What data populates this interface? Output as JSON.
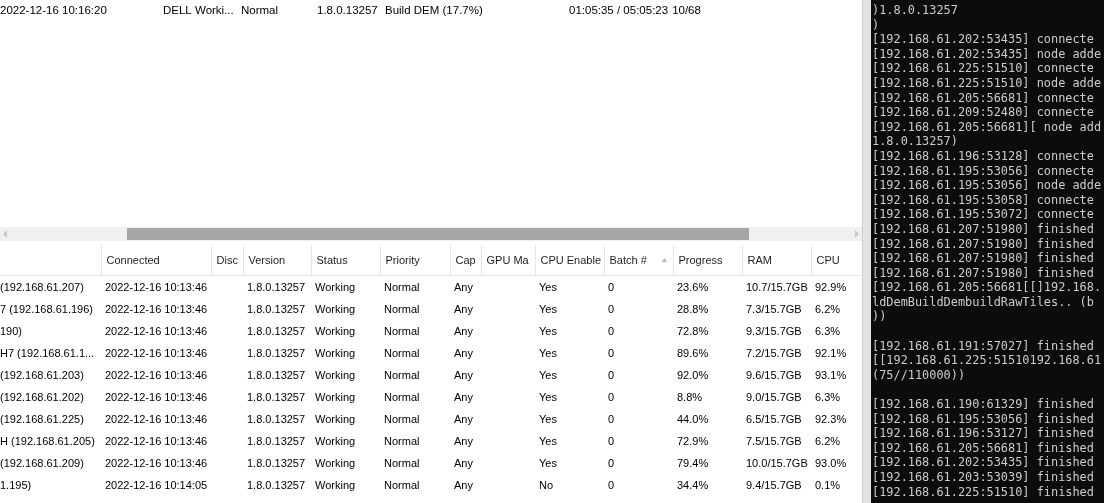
{
  "jobs_list": {
    "rows": [
      {
        "cells": [
          "2022-12-16 10:16:20",
          "DELL",
          "Worki...",
          "Normal",
          "1.8.0.13257",
          "Build DEM (17.7%)",
          "01:05:35 / 05:05:23",
          "10/68"
        ]
      }
    ]
  },
  "nodes_table": {
    "columns": [
      {
        "sort_ascending": false
      },
      {
        "label": "Connected",
        "sort_ascending": false
      },
      {
        "label": "Disc",
        "sort_ascending": false
      },
      {
        "label": "Version",
        "sort_ascending": false
      },
      {
        "label": "Status",
        "sort_ascending": false
      },
      {
        "label": "Priority",
        "sort_ascending": false
      },
      {
        "label": "Cap",
        "sort_ascending": false
      },
      {
        "label": "GPU Ma",
        "sort_ascending": false
      },
      {
        "label": "CPU Enable",
        "sort_ascending": false
      },
      {
        "label": "Batch #",
        "sort_ascending": true
      },
      {
        "label": "Progress",
        "sort_ascending": false
      },
      {
        "label": "RAM",
        "sort_ascending": false
      },
      {
        "label": "CPU",
        "sort_ascending": false
      }
    ],
    "rows": [
      {
        "cells": [
          "(192.168.61.207)",
          "2022-12-16 10:13:46",
          null,
          "1.8.0.13257",
          "Working",
          "Normal",
          "Any",
          null,
          "Yes",
          "0",
          "23.6%",
          "10.7/15.7GB",
          "92.9%"
        ]
      },
      {
        "cells": [
          "7 (192.168.61.196)",
          "2022-12-16 10:13:46",
          null,
          "1.8.0.13257",
          "Working",
          "Normal",
          "Any",
          null,
          "Yes",
          "0",
          "28.8%",
          "7.3/15.7GB",
          "6.2%"
        ]
      },
      {
        "cells": [
          "190)",
          "2022-12-16 10:13:46",
          null,
          "1.8.0.13257",
          "Working",
          "Normal",
          "Any",
          null,
          "Yes",
          "0",
          "72.8%",
          "9.3/15.7GB",
          "6.3%"
        ]
      },
      {
        "cells": [
          "H7 (192.168.61.1...",
          "2022-12-16 10:13:46",
          null,
          "1.8.0.13257",
          "Working",
          "Normal",
          "Any",
          null,
          "Yes",
          "0",
          "89.6%",
          "7.2/15.7GB",
          "92.1%"
        ]
      },
      {
        "cells": [
          "(192.168.61.203)",
          "2022-12-16 10:13:46",
          null,
          "1.8.0.13257",
          "Working",
          "Normal",
          "Any",
          null,
          "Yes",
          "0",
          "92.0%",
          "9.6/15.7GB",
          "93.1%"
        ]
      },
      {
        "cells": [
          "(192.168.61.202)",
          "2022-12-16 10:13:46",
          null,
          "1.8.0.13257",
          "Working",
          "Normal",
          "Any",
          null,
          "Yes",
          "0",
          "8.8%",
          "9.0/15.7GB",
          "6.3%"
        ]
      },
      {
        "cells": [
          "(192.168.61.225)",
          "2022-12-16 10:13:46",
          null,
          "1.8.0.13257",
          "Working",
          "Normal",
          "Any",
          null,
          "Yes",
          "0",
          "44.0%",
          "6.5/15.7GB",
          "92.3%"
        ]
      },
      {
        "cells": [
          "H (192.168.61.205)",
          "2022-12-16 10:13:46",
          null,
          "1.8.0.13257",
          "Working",
          "Normal",
          "Any",
          null,
          "Yes",
          "0",
          "72.9%",
          "7.5/15.7GB",
          "6.2%"
        ]
      },
      {
        "cells": [
          "(192.168.61.209)",
          "2022-12-16 10:13:46",
          null,
          "1.8.0.13257",
          "Working",
          "Normal",
          "Any",
          null,
          "Yes",
          "0",
          "79.4%",
          "10.0/15.7GB",
          "93.0%"
        ]
      },
      {
        "cells": [
          "1.195)",
          "2022-12-16 10:14:05",
          null,
          "1.8.0.13257",
          "Working",
          "Normal",
          "Any",
          null,
          "No",
          "0",
          "34.4%",
          "9.4/15.7GB",
          "0.1%"
        ]
      }
    ]
  },
  "console": {
    "lines": [
      {
        "text": ")1.8.0.13257",
        "blank_before": false
      },
      {
        "text": ")",
        "blank_before": false
      },
      {
        "text": "[192.168.61.202:53435] connecte",
        "blank_before": false
      },
      {
        "text": "[192.168.61.202:53435] node adde",
        "blank_before": false
      },
      {
        "text": "[192.168.61.225:51510] connecte",
        "blank_before": false
      },
      {
        "text": "[192.168.61.225:51510] node adde",
        "blank_before": false
      },
      {
        "text": "[192.168.61.205:56681] connecte",
        "blank_before": false
      },
      {
        "text": "[192.168.61.209:52480] connecte",
        "blank_before": false
      },
      {
        "text": "[192.168.61.205:56681][ node add",
        "blank_before": false
      },
      {
        "text": "1.8.0.13257)",
        "blank_before": false
      },
      {
        "text": "[192.168.61.196:53128] connecte",
        "blank_before": false
      },
      {
        "text": "[192.168.61.195:53056] connecte",
        "blank_before": false
      },
      {
        "text": "[192.168.61.195:53056] node adde",
        "blank_before": false
      },
      {
        "text": "[192.168.61.195:53058] connecte",
        "blank_before": false
      },
      {
        "text": "[192.168.61.195:53072] connecte",
        "blank_before": false
      },
      {
        "text": "[192.168.61.207:51980] finished",
        "blank_before": false
      },
      {
        "text": "[192.168.61.207:51980] finished",
        "blank_before": false
      },
      {
        "text": "[192.168.61.207:51980] finished",
        "blank_before": false
      },
      {
        "text": "[192.168.61.207:51980] finished",
        "blank_before": false
      },
      {
        "text": "[192.168.61.205:56681[[]192.168.",
        "blank_before": false
      },
      {
        "text": "ldDemBuildDembuildRawTiles.. (b",
        "blank_before": false
      },
      {
        "text": "))",
        "blank_before": false
      },
      {
        "text": "[192.168.61.191:57027] finished",
        "blank_before": true
      },
      {
        "text": "[[192.168.61.225:51510192.168.61",
        "blank_before": false
      },
      {
        "text": "(75//110000))",
        "blank_before": false
      },
      {
        "text": "[192.168.61.190:61329] finished",
        "blank_before": true
      },
      {
        "text": "[192.168.61.195:53056] finished",
        "blank_before": false
      },
      {
        "text": "[192.168.61.196:53127] finished",
        "blank_before": false
      },
      {
        "text": "[192.168.61.205:56681] finished",
        "blank_before": false
      },
      {
        "text": "[192.168.61.202:53435] finished",
        "blank_before": false
      },
      {
        "text": "[192.168.61.203:53039] finished",
        "blank_before": false
      },
      {
        "text": "[192.168.61.225:51510] finished",
        "blank_before": false
      }
    ]
  }
}
